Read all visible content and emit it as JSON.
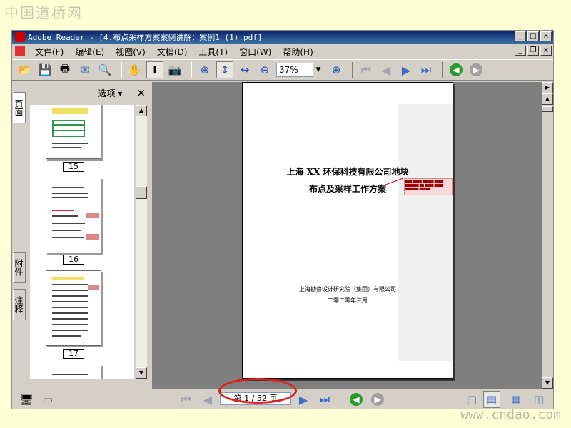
{
  "watermarks": {
    "top": "中国道桥网",
    "bottom": "www.cndao.com"
  },
  "window": {
    "title": "Adobe Reader - [4.布点采样方案案例讲解：案例1 (1).pdf]"
  },
  "menu": [
    "文件(F)",
    "编辑(E)",
    "视图(V)",
    "文档(D)",
    "工具(T)",
    "窗口(W)",
    "帮助(H)"
  ],
  "toolbar": {
    "zoom": "37%"
  },
  "side_tabs": [
    "页面",
    "附件",
    "注释"
  ],
  "panel": {
    "options_label": "选项 ▾",
    "close": "×"
  },
  "thumbnails": [
    {
      "label": "15"
    },
    {
      "label": "16"
    },
    {
      "label": "17"
    }
  ],
  "document": {
    "title_line1": "上海 XX 环保科技有限公司地块",
    "title_line2": "布点及采样工作方案",
    "org": "上海勘察设计研究院（集团）有限公司",
    "date": "二零二零年三月"
  },
  "status": {
    "page_indicator": "第 1 / 52 页"
  },
  "colors": {
    "title_bar": "#0a246a",
    "highlight": "#e02020",
    "workspace": "#7f7f7f"
  }
}
